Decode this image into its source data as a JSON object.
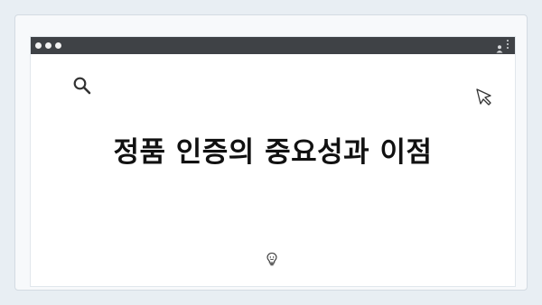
{
  "window": {
    "indicator_dots": 4
  },
  "browser": {
    "titlebar_controls": [
      "dot",
      "dot",
      "dot"
    ],
    "right_icons": [
      "user-icon",
      "kebab-menu-icon"
    ]
  },
  "canvas": {
    "headline": "정품 인증의 중요성과 이점",
    "icons": [
      "search-icon",
      "cursor-icon",
      "lightbulb-icon"
    ]
  },
  "colors": {
    "background": "#e8eef3",
    "titlebar": "#3f4246",
    "headline": "#111111"
  }
}
